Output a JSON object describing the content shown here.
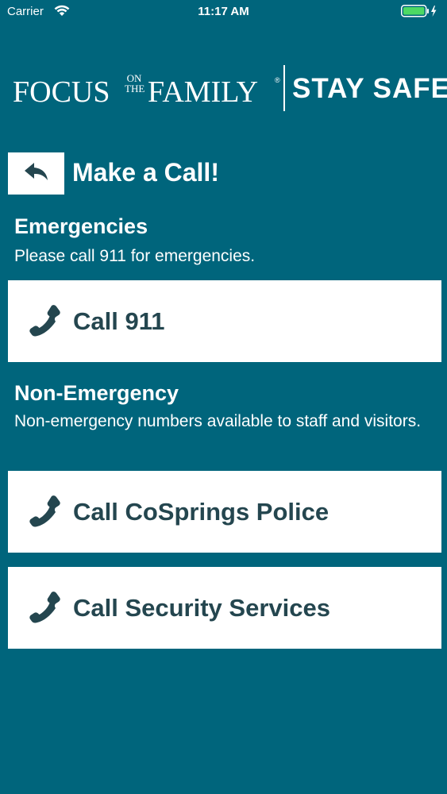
{
  "status_bar": {
    "carrier": "Carrier",
    "time": "11:17 AM"
  },
  "header": {
    "logo_focus": "FOCUS",
    "logo_on": "ON",
    "logo_the": "THE",
    "logo_family": "FAMILY",
    "logo_reg": "®",
    "logo_stay_safe": "STAY SAFE"
  },
  "page": {
    "title": "Make a Call!"
  },
  "emergencies": {
    "heading": "Emergencies",
    "description": "Please call 911 for emergencies.",
    "button_label": "Call 911"
  },
  "non_emergency": {
    "heading": "Non-Emergency",
    "description": "Non-emergency numbers available to staff and visitors.",
    "buttons": [
      {
        "label": "Call CoSprings Police"
      },
      {
        "label": "Call Security Services"
      }
    ]
  },
  "colors": {
    "background": "#00657c",
    "button_bg": "#ffffff",
    "button_text": "#24464f",
    "battery": "#4cd964"
  },
  "icons": {
    "back": "back-arrow-icon",
    "phone": "phone-icon",
    "wifi": "wifi-icon",
    "battery": "battery-icon",
    "charging": "charging-bolt-icon"
  }
}
